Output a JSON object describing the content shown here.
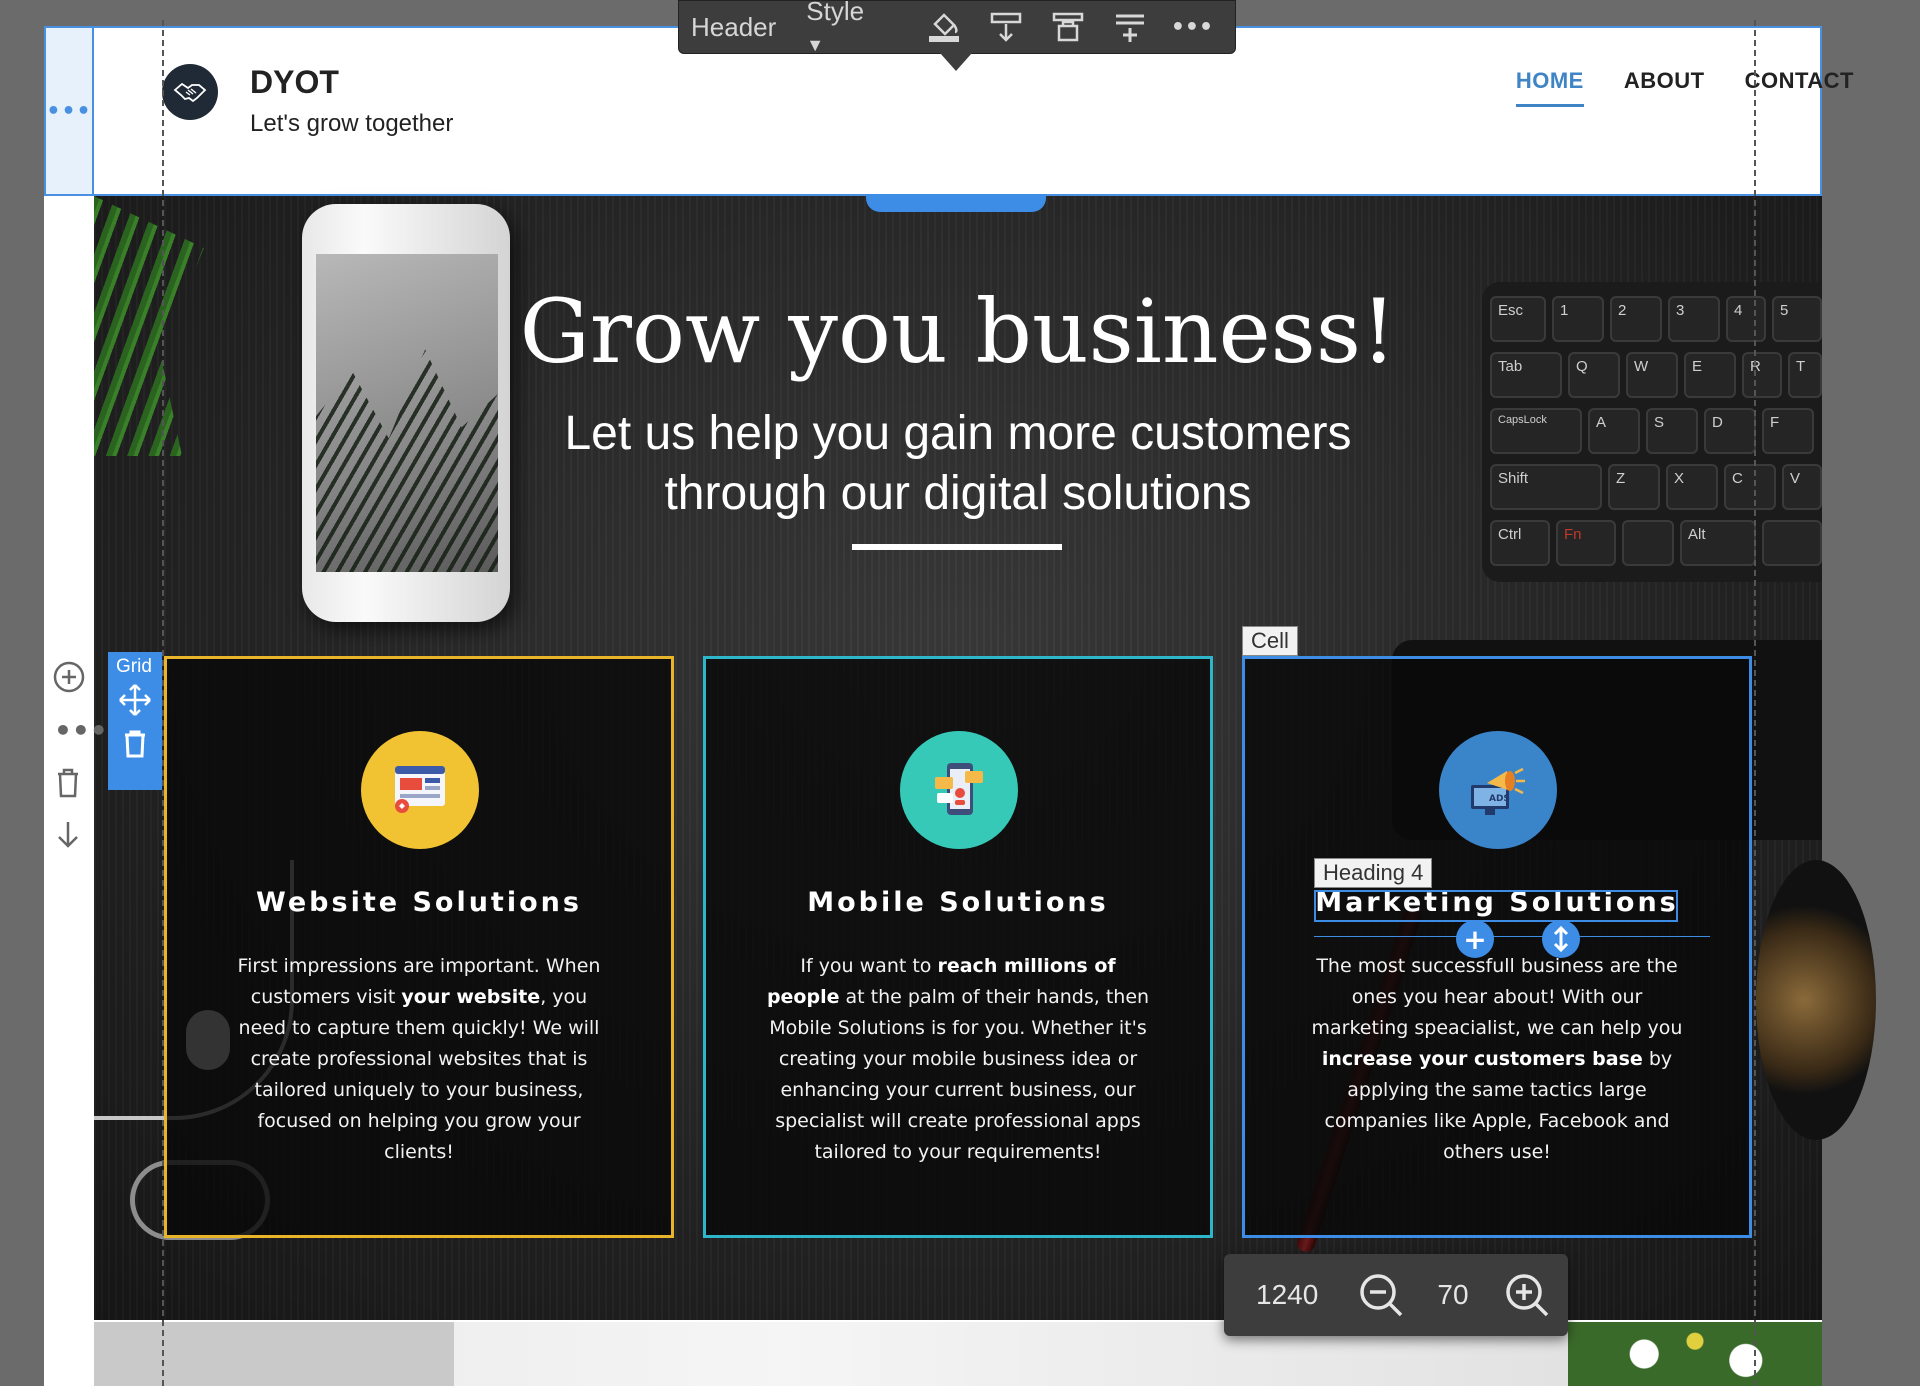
{
  "toolbar": {
    "element_label": "Header",
    "style_label": "Style",
    "icons": [
      "paint-bucket-icon",
      "insert-below-icon",
      "lock-icon",
      "insert-section-icon",
      "more-icon"
    ]
  },
  "header": {
    "brand_name": "DYOT",
    "tagline": "Let's grow together",
    "logo_icon": "handshake-icon",
    "nav": [
      {
        "label": "HOME",
        "active": true
      },
      {
        "label": "ABOUT",
        "active": false
      },
      {
        "label": "CONTACT",
        "active": false
      }
    ]
  },
  "hero": {
    "title": "Grow you business!",
    "subtitle_line1": "Let us help you gain more customers",
    "subtitle_line2": "through our digital solutions"
  },
  "keyboard": {
    "keys": [
      "Esc",
      "1",
      "2",
      "3",
      "4",
      "5",
      "Tab",
      "Q",
      "W",
      "E",
      "R",
      "T",
      "CapsLock",
      "A",
      "S",
      "D",
      "F",
      "Shift",
      "Z",
      "X",
      "C",
      "V",
      "Ctrl",
      "Fn",
      "Alt"
    ]
  },
  "labels": {
    "grid": "Grid",
    "cell": "Cell",
    "heading4": "Heading 4"
  },
  "cells": [
    {
      "heading": "Website Solutions",
      "icon": "website-icon",
      "icon_color": "#f1c232",
      "text_parts": [
        "First impressions are important. When customers visit ",
        "your website",
        ", you need to capture them quickly! We will create professional websites that is tailored uniquely to your business, focused on helping you grow your clients!"
      ]
    },
    {
      "heading": "Mobile Solutions",
      "icon": "mobile-icon",
      "icon_color": "#36c9b8",
      "text_parts": [
        "If you want to ",
        "reach millions of people",
        " at the palm of their hands, then Mobile Solutions is for you. Whether it's creating your mobile business idea or enhancing your current business, our specialist will create professional apps tailored to your requirements!"
      ]
    },
    {
      "heading": "Marketing Solutions",
      "icon": "megaphone-ads-icon",
      "icon_color": "#3a84c9",
      "icon_text": "ADS",
      "text_parts": [
        "The most successfull business are the ones you hear about! With our marketing speacialist, we can help you ",
        "increase your customers base",
        " by applying the same tactics large companies like Apple, Facebook and others use!"
      ]
    }
  ],
  "zoom": {
    "width": "1240",
    "level": "70"
  },
  "colors": {
    "accent": "#3d8de6",
    "nav_active": "#3f84c5",
    "toolbar_bg": "#3d3d3d",
    "cell1_border": "#e7b42a",
    "cell2_border": "#2fb5c9",
    "cell3_border": "#3d8de6"
  }
}
